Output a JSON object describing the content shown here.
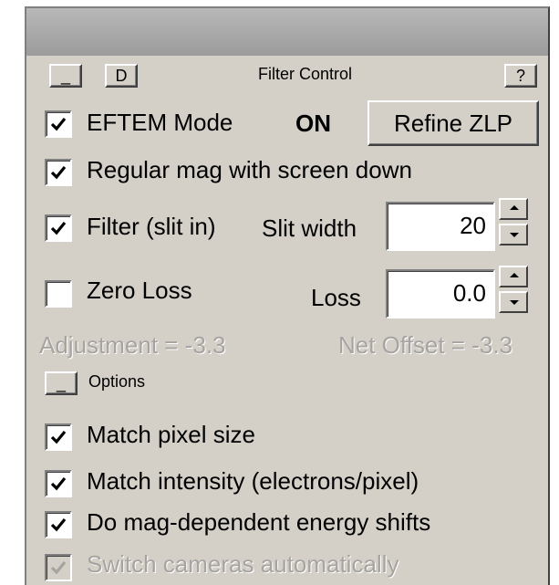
{
  "header": {
    "collapse_label": "_",
    "d_label": "D",
    "title": "Filter Control",
    "help_label": "?"
  },
  "eftem": {
    "label": "EFTEM Mode",
    "checked": true,
    "status": "ON",
    "refine_label": "Refine ZLP"
  },
  "regular_mag": {
    "label": "Regular mag with screen down",
    "checked": true
  },
  "filter": {
    "label": "Filter (slit in)",
    "checked": true,
    "slit_width_label": "Slit width",
    "slit_width_value": "20"
  },
  "zero_loss": {
    "label": "Zero Loss",
    "checked": false,
    "loss_label": "Loss",
    "loss_value": "0.0"
  },
  "readouts": {
    "adjustment": "Adjustment = -3.3",
    "net_offset": "Net Offset = -3.3"
  },
  "options": {
    "collapse_label": "_",
    "label": "Options",
    "items": [
      {
        "label": "Match pixel size",
        "checked": true,
        "enabled": true
      },
      {
        "label": "Match intensity (electrons/pixel)",
        "checked": true,
        "enabled": true
      },
      {
        "label": "Do mag-dependent energy shifts",
        "checked": true,
        "enabled": true
      },
      {
        "label": "Switch cameras automatically",
        "checked": true,
        "enabled": false
      }
    ]
  },
  "colors": {
    "panel": "#d4d0c8",
    "titlebar": "#a8a8a8",
    "disabled_text": "#a6a3a0"
  }
}
